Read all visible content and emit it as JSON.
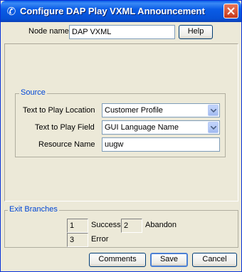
{
  "window": {
    "title": "Configure DAP Play VXML Announcement"
  },
  "header": {
    "node_name_label": "Node name",
    "node_name_value": "DAP VXML",
    "help_label": "Help"
  },
  "source": {
    "legend": "Source",
    "text_location_label": "Text to Play Location",
    "text_location_value": "Customer Profile",
    "text_field_label": "Text to Play Field",
    "text_field_value": "GUI Language Name",
    "resource_name_label": "Resource Name",
    "resource_name_value": "uugw"
  },
  "exit_branches": {
    "legend": "Exit Branches",
    "items": [
      {
        "number": "1",
        "label": "Success"
      },
      {
        "number": "2",
        "label": "Abandon"
      },
      {
        "number": "3",
        "label": "Error"
      }
    ]
  },
  "footer": {
    "comments_label": "Comments",
    "save_label": "Save",
    "cancel_label": "Cancel"
  }
}
